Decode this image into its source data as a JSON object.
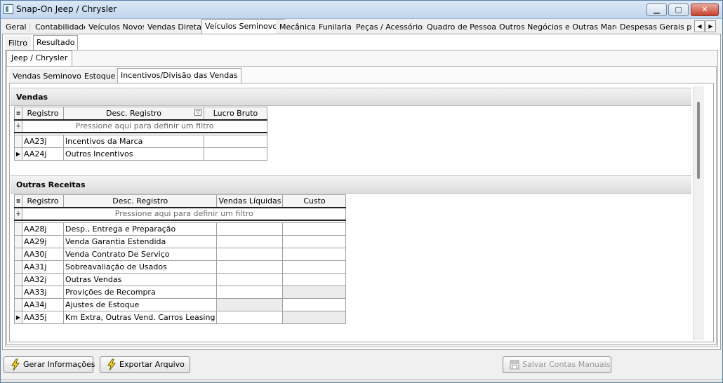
{
  "window": {
    "title": "Snap-On Jeep / Chrysler"
  },
  "main_tabs": [
    "Geral",
    "Contabilidade",
    "Veículos Novos",
    "Vendas Diretas",
    "Veículos Seminovos",
    "Mecânica",
    "Funilaria",
    "Peças / Acessórios",
    "Quadro de Pessoas",
    "Outros Negócios e Outras Marcas",
    "Despesas Gerais por De"
  ],
  "main_active": "Veículos Seminovos",
  "sub_tabs": [
    "Filtro",
    "Resultado"
  ],
  "brand_tab": "Jeep / Chrysler",
  "section_tabs": [
    "Vendas Seminovos",
    "Estoque",
    "Incentivos/Divisão das Vendas"
  ],
  "vendas": {
    "title": "Vendas",
    "columns": [
      "Registro",
      "Desc. Registro",
      "Lucro Bruto"
    ],
    "filter_hint": "Pressione aqui para definir um filtro",
    "rows": [
      {
        "registro": "AA23j",
        "desc": "Incentivos da Marca"
      },
      {
        "registro": "AA24j",
        "desc": "Outros Incentivos"
      }
    ]
  },
  "outras": {
    "title": "Outras Receitas",
    "columns": [
      "Registro",
      "Desc. Registro",
      "Vendas Líquidas",
      "Custo"
    ],
    "filter_hint": "Pressione aqui para definir um filtro",
    "rows": [
      {
        "registro": "AA28j",
        "desc": "Desp., Entrega e Preparação"
      },
      {
        "registro": "AA29j",
        "desc": "Venda Garantia Estendida"
      },
      {
        "registro": "AA30j",
        "desc": "Venda Contrato De Serviço"
      },
      {
        "registro": "AA31j",
        "desc": "Sobreavaliação de Usados"
      },
      {
        "registro": "AA32j",
        "desc": "Outras Vendas"
      },
      {
        "registro": "AA33j",
        "desc": "Provições de Recompra"
      },
      {
        "registro": "AA34j",
        "desc": "Ajustes de Estoque"
      },
      {
        "registro": "AA35j",
        "desc": "Km Extra, Outras Vend. Carros Leasing"
      }
    ]
  },
  "buttons": {
    "gerar": "Gerar Informações",
    "exportar": "Exportar Arquivo",
    "salvar": "Salvar Contas Manuais"
  }
}
